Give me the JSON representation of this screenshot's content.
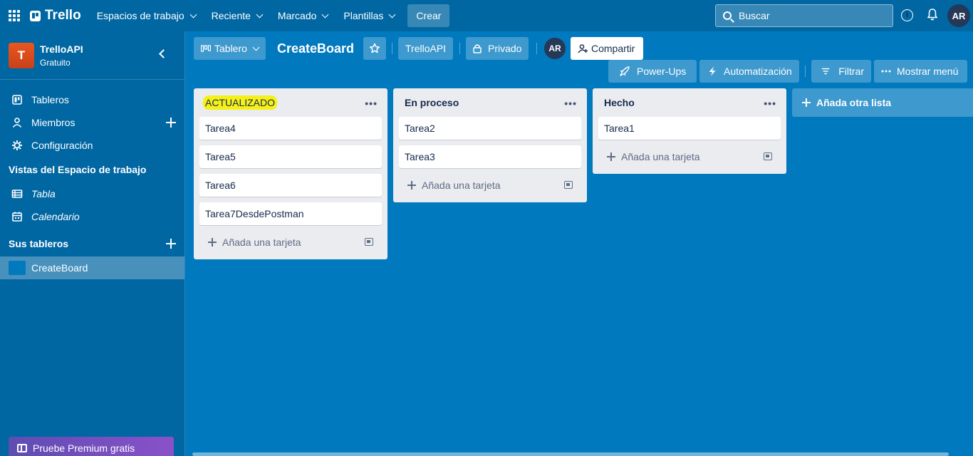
{
  "topnav": {
    "logo": "Trello",
    "menus": [
      "Espacios de trabajo",
      "Reciente",
      "Marcado",
      "Plantillas"
    ],
    "create": "Crear",
    "search_placeholder": "Buscar",
    "info_icon": "i",
    "user_initials": "AR"
  },
  "sidebar": {
    "workspace_initial": "T",
    "workspace_name": "TrelloAPI",
    "workspace_plan": "Gratuito",
    "items": [
      {
        "label": "Tableros",
        "icon": "board-icon"
      },
      {
        "label": "Miembros",
        "icon": "person-icon"
      },
      {
        "label": "Configuración",
        "icon": "gear-icon"
      }
    ],
    "views_title": "Vistas del Espacio de trabajo",
    "views": [
      {
        "label": "Tabla",
        "icon": "table-icon"
      },
      {
        "label": "Calendario",
        "icon": "calendar-icon"
      }
    ],
    "boards_title": "Sus tableros",
    "boards": [
      {
        "label": "CreateBoard"
      }
    ],
    "premium": "Pruebe Premium gratis"
  },
  "board_header": {
    "view": "Tablero",
    "title": "CreateBoard",
    "workspace": "TrelloAPI",
    "visibility": "Privado",
    "member_initials": "AR",
    "share": "Compartir",
    "powerups": "Power-Ups",
    "automation": "Automatización",
    "filter": "Filtrar",
    "menu": "Mostrar menú"
  },
  "lists": [
    {
      "title": "ACTUALIZADO",
      "highlighted": true,
      "cards": [
        "Tarea4",
        "Tarea5",
        "Tarea6",
        "Tarea7DesdePostman"
      ],
      "add_card": "Añada una tarjeta"
    },
    {
      "title": "En proceso",
      "highlighted": false,
      "cards": [
        "Tarea2",
        "Tarea3"
      ],
      "add_card": "Añada una tarjeta"
    },
    {
      "title": "Hecho",
      "highlighted": false,
      "cards": [
        "Tarea1"
      ],
      "add_card": "Añada una tarjeta"
    }
  ],
  "add_list": "Añada otra lista",
  "colors": {
    "board_bg": "#0079bf",
    "nav_bg": "#0067a3",
    "list_bg": "#ebecf0",
    "highlight": "#f6f019"
  }
}
